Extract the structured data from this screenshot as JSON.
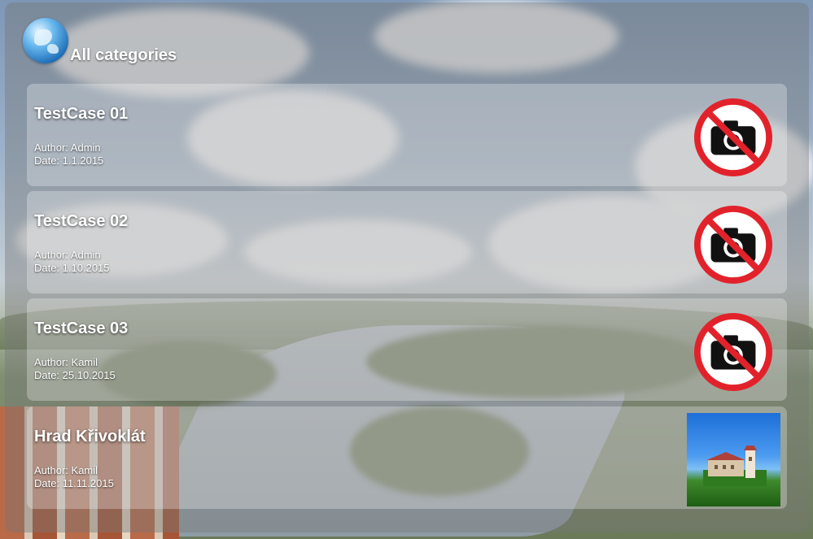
{
  "header": {
    "title": "All categories",
    "icon": "globe-icon"
  },
  "cards": [
    {
      "title": "TestCase 01",
      "author": "Author: Admin",
      "date": "Date: 1.1.2015",
      "image": "no-photo-icon"
    },
    {
      "title": "TestCase 02",
      "author": "Author: Admin",
      "date": "Date: 1.10.2015",
      "image": "no-photo-icon"
    },
    {
      "title": "TestCase 03",
      "author": "Author: Kamil",
      "date": "Date: 25.10.2015",
      "image": "no-photo-icon"
    },
    {
      "title": "Hrad Křivoklát",
      "author": "Author: Kamil",
      "date": "Date: 11.11.2015",
      "image": "castle-thumbnail"
    }
  ],
  "colors": {
    "no_photo_red": "#e2222b",
    "panel_overlay": "rgba(120,120,120,0.42)"
  }
}
